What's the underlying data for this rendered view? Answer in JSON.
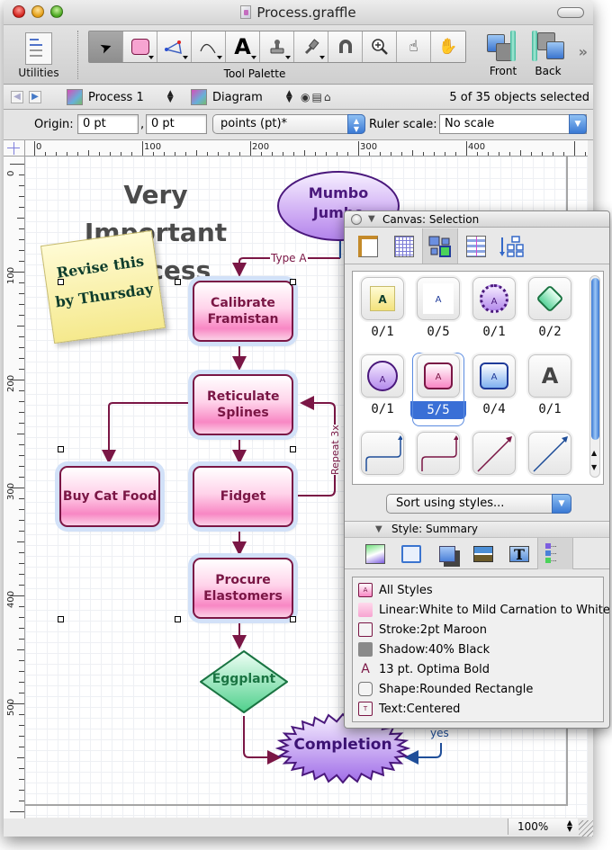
{
  "window": {
    "title": "Process.graffle"
  },
  "toolbar": {
    "utilities_label": "Utilities",
    "tool_palette_label": "Tool Palette",
    "front_label": "Front",
    "back_label": "Back",
    "overflow_glyph": "»",
    "tools": [
      {
        "name": "selection-tool",
        "glyph": "➤",
        "selected": true
      },
      {
        "name": "shape-tool",
        "glyph": "",
        "menu": true
      },
      {
        "name": "magnet-line-tool",
        "glyph": "",
        "menu": true
      },
      {
        "name": "line-tool",
        "glyph": "↘",
        "menu": true
      },
      {
        "name": "text-tool",
        "glyph": "A",
        "menu": true
      },
      {
        "name": "stamp-tool",
        "glyph": "⚲",
        "menu": true
      },
      {
        "name": "style-brush-tool",
        "glyph": "✎",
        "menu": true
      },
      {
        "name": "magnet-tool",
        "glyph": "∩"
      },
      {
        "name": "zoom-tool",
        "glyph": "⊕"
      },
      {
        "name": "browse-tool",
        "glyph": "☝"
      },
      {
        "name": "hand-tool",
        "glyph": "✋"
      }
    ]
  },
  "navbar": {
    "canvas_select": "Process 1",
    "layer_select": "Diagram",
    "selection_status": "5 of 35 objects selected"
  },
  "rulerbar": {
    "origin_label": "Origin:",
    "origin_x": "0 pt",
    "origin_sep": ",",
    "origin_y": "0 pt",
    "units": "points (pt)*",
    "ruler_scale_label": "Ruler scale:",
    "ruler_scale": "No scale"
  },
  "rulers": {
    "h_labels": [
      "0",
      "100",
      "200",
      "300",
      "400"
    ],
    "v_labels": [
      "0",
      "100",
      "200",
      "300",
      "400",
      "500"
    ]
  },
  "diagram": {
    "title_line1": "Very Important",
    "title_line2": "Process",
    "sticky_note": "Revise this by Thursday",
    "nodes": {
      "mumbo": "Mumbo Jumbo",
      "calibrate": "Calibrate Framistan",
      "reticulate": "Reticulate Splines",
      "buy_cat_food": "Buy Cat Food",
      "fidget": "Fidget",
      "procure": "Procure Elastomers",
      "eggplant": "Eggplant",
      "completion": "Completion"
    },
    "edge_labels": {
      "type_a": "Type A",
      "repeat": "Repeat 3x",
      "yes": "yes"
    },
    "colors": {
      "node_stroke": "#7a1645",
      "node_fill": "#f887c4",
      "selection_glow": "#d2e1f8",
      "diamond_stroke": "#1a7442",
      "ellipse_stroke": "#4a187c",
      "yes_line": "#1f4e99"
    }
  },
  "statusbar": {
    "zoom": "100%"
  },
  "inspector": {
    "title": "Canvas: Selection",
    "tabs": [
      "canvas-size",
      "grid",
      "styles",
      "alignment",
      "diagram-layout"
    ],
    "active_tab": "styles",
    "swatches": [
      {
        "kind": "sticky",
        "count": "0/1"
      },
      {
        "kind": "plain-text",
        "count": "0/5"
      },
      {
        "kind": "purple-burst",
        "count": "0/1"
      },
      {
        "kind": "green-diamond",
        "count": "0/2"
      },
      {
        "kind": "purple-ellipse",
        "count": "0/1"
      },
      {
        "kind": "pink-rounded-rect",
        "count": "5/5",
        "selected": true
      },
      {
        "kind": "blue-rounded-rect",
        "count": "0/4"
      },
      {
        "kind": "bold-text",
        "count": "0/1"
      },
      {
        "kind": "blue-orthogonal-line",
        "count": ""
      },
      {
        "kind": "maroon-orthogonal-line",
        "count": ""
      },
      {
        "kind": "maroon-straight-line",
        "count": ""
      },
      {
        "kind": "blue-straight-line",
        "count": ""
      }
    ],
    "sort_popup": "Sort using styles...",
    "style_section_title": "Style: Summary",
    "style_tabs": [
      "fill",
      "lines-and-shapes",
      "shadow",
      "image",
      "text",
      "summary"
    ],
    "summary_items": [
      {
        "icon": "all-styles",
        "label": "All Styles"
      },
      {
        "icon": "fill-swatch",
        "label": "Linear:White to Mild Carnation to White"
      },
      {
        "icon": "stroke-swatch",
        "label": "Stroke:2pt Maroon"
      },
      {
        "icon": "shadow-swatch",
        "label": "Shadow:40% Black"
      },
      {
        "icon": "font-glyph",
        "label": "13 pt. Optima Bold"
      },
      {
        "icon": "shape-swatch",
        "label": "Shape:Rounded Rectangle"
      },
      {
        "icon": "text-swatch",
        "label": "Text:Centered"
      }
    ]
  }
}
